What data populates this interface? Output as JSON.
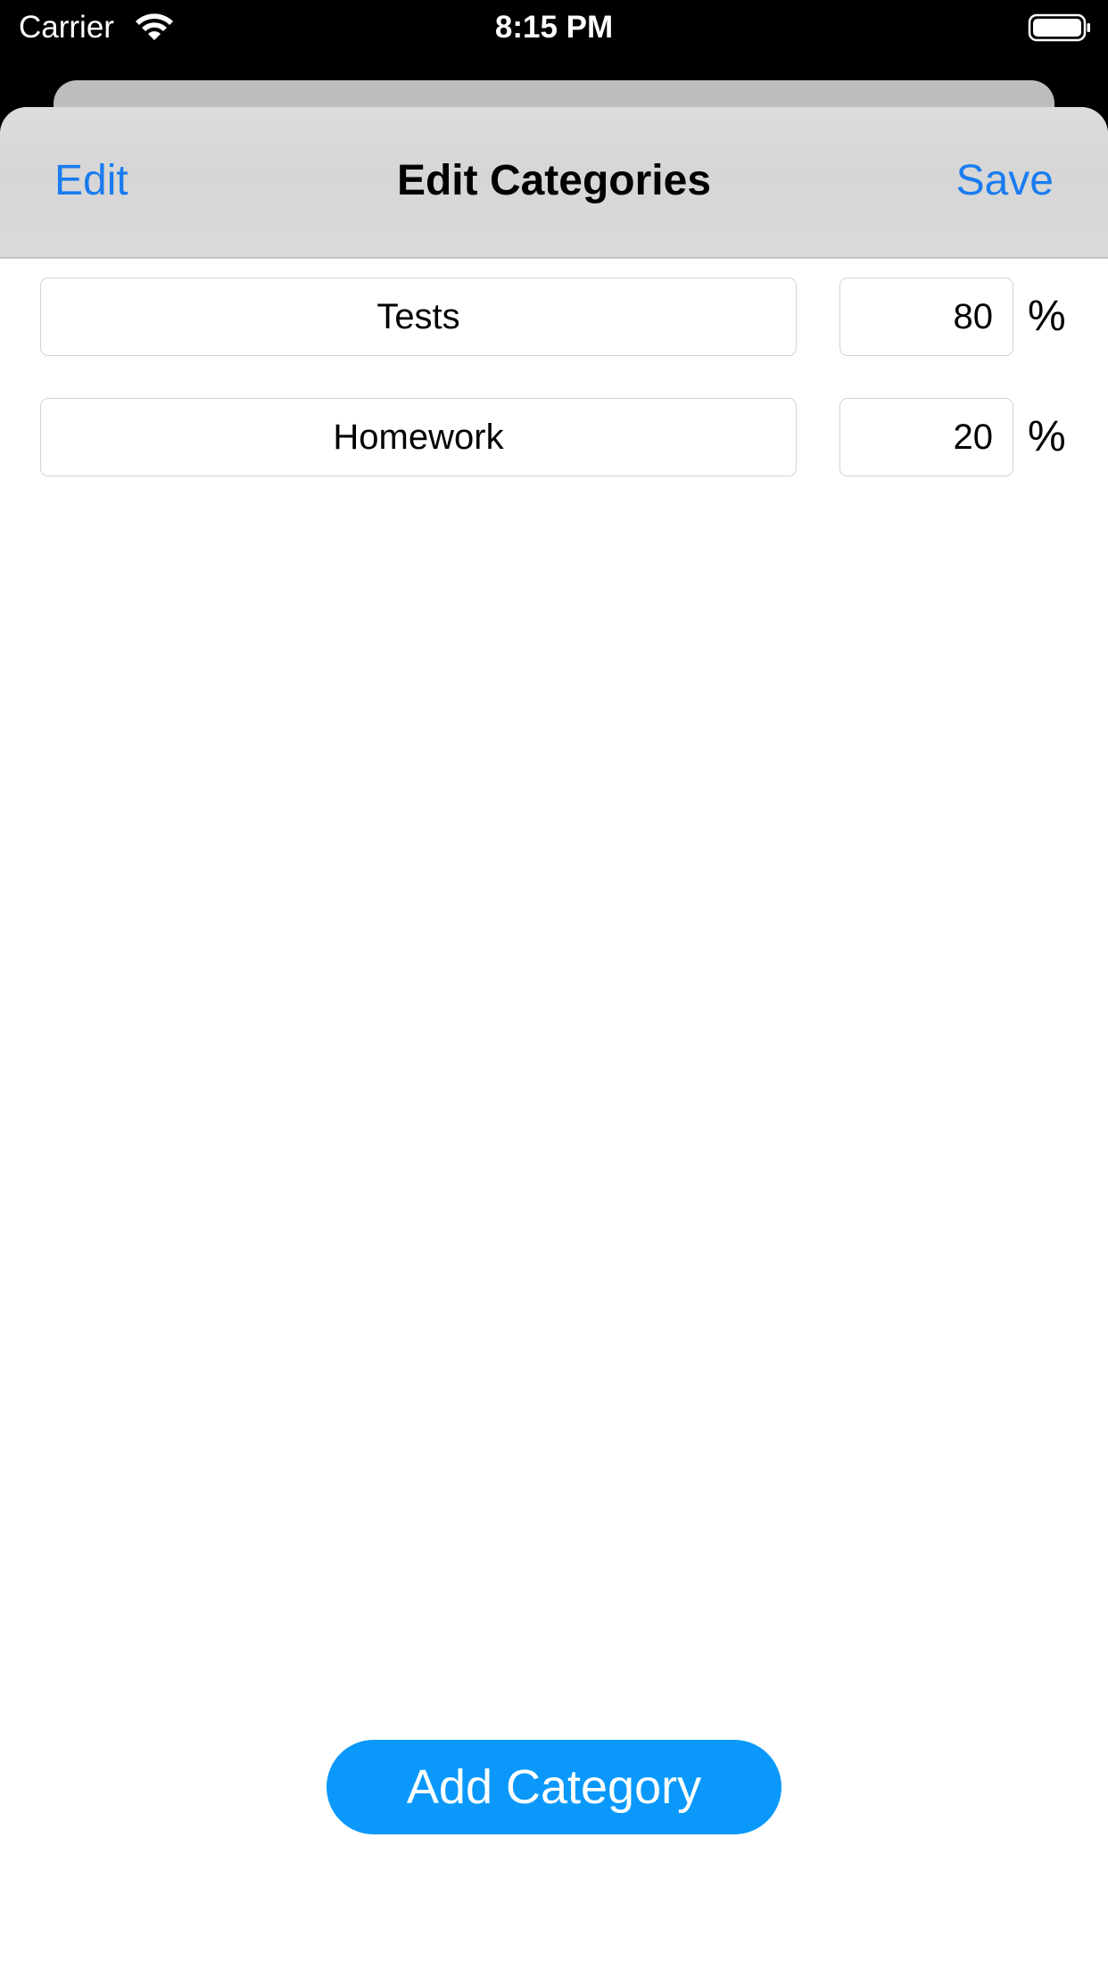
{
  "status_bar": {
    "carrier": "Carrier",
    "time": "8:15 PM",
    "wifi_icon": "wifi-icon",
    "battery_icon": "battery-full-icon"
  },
  "nav": {
    "edit_label": "Edit",
    "title": "Edit Categories",
    "save_label": "Save"
  },
  "categories": [
    {
      "name": "Tests",
      "percent": "80",
      "percent_sign": "%"
    },
    {
      "name": "Homework",
      "percent": "20",
      "percent_sign": "%"
    }
  ],
  "add_button_label": "Add Category",
  "colors": {
    "accent": "#1a7cf0",
    "button": "#0a99fb"
  }
}
